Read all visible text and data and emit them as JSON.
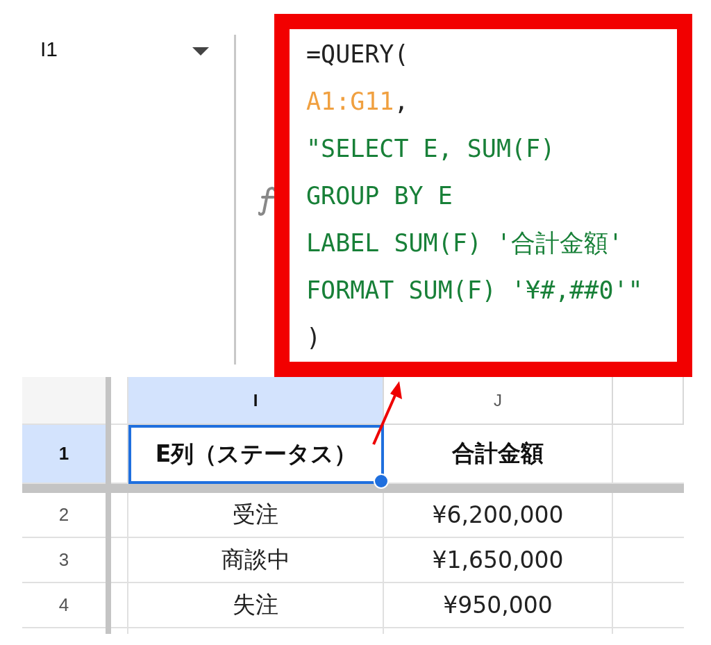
{
  "name_box": {
    "value": "I1"
  },
  "formula": {
    "lines": [
      [
        {
          "kind": "plain",
          "text": "=QUERY("
        }
      ],
      [
        {
          "kind": "range",
          "text": "A1:G11"
        },
        {
          "kind": "plain",
          "text": ","
        }
      ],
      [
        {
          "kind": "string",
          "text": "\"SELECT E, SUM(F)"
        }
      ],
      [
        {
          "kind": "string",
          "text": "GROUP BY E"
        }
      ],
      [
        {
          "kind": "string",
          "text": "LABEL SUM(F) '合計金額'"
        }
      ],
      [
        {
          "kind": "string",
          "text": "FORMAT SUM(F) '¥#,##0'\""
        }
      ],
      [
        {
          "kind": "plain",
          "text": ")"
        }
      ]
    ]
  },
  "grid": {
    "columns": [
      {
        "label": "I",
        "selected": true
      },
      {
        "label": "J",
        "selected": false
      }
    ],
    "rows": [
      {
        "number": "1",
        "selected": true,
        "bold": true,
        "cells": [
          {
            "text": "E列（ステータス）",
            "active": true
          },
          {
            "text": "合計金額",
            "active": false
          }
        ]
      },
      {
        "number": "2",
        "selected": false,
        "bold": false,
        "cells": [
          {
            "text": "受注",
            "active": false
          },
          {
            "text": "¥6,200,000",
            "active": false
          }
        ]
      },
      {
        "number": "3",
        "selected": false,
        "bold": false,
        "cells": [
          {
            "text": "商談中",
            "active": false
          },
          {
            "text": "¥1,650,000",
            "active": false
          }
        ]
      },
      {
        "number": "4",
        "selected": false,
        "bold": false,
        "cells": [
          {
            "text": "失注",
            "active": false
          },
          {
            "text": "¥950,000",
            "active": false
          }
        ]
      }
    ]
  }
}
